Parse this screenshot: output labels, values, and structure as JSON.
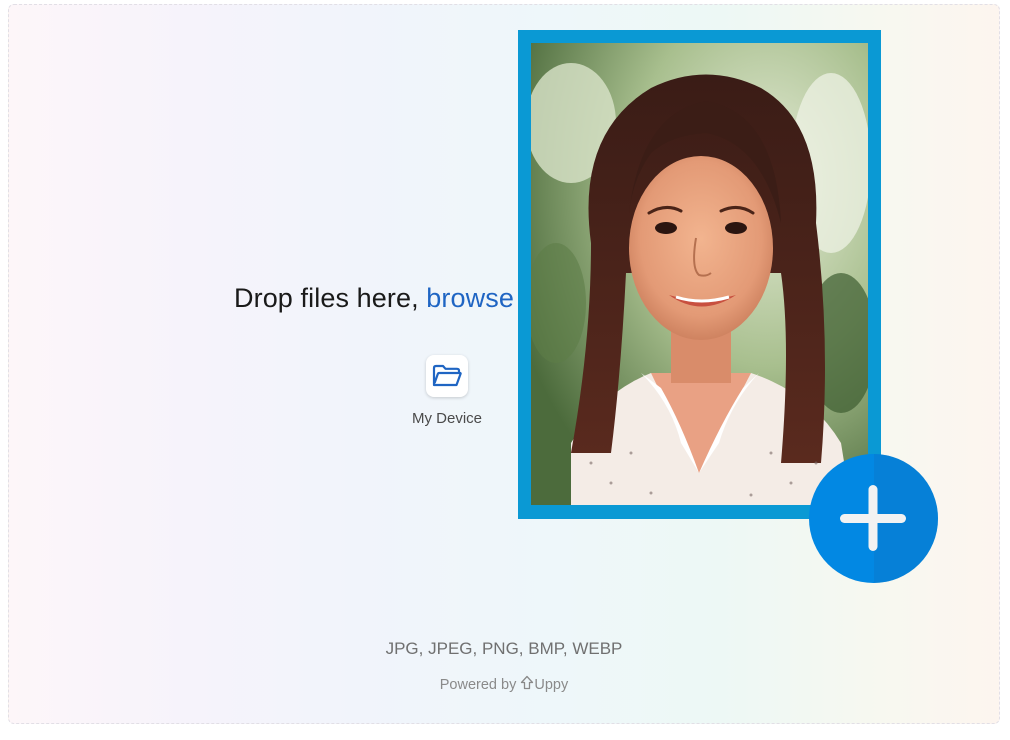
{
  "dropzone": {
    "title_prefix": "Drop files here, ",
    "browse_label": "browse"
  },
  "sources": [
    {
      "label": "My Device",
      "icon": "folder-icon"
    }
  ],
  "file_types": "JPG, JPEG, PNG, BMP, WEBP",
  "footer": {
    "powered_by": "Powered by",
    "brand": "Uppy",
    "brand_icon": "uppy-arrow-icon"
  },
  "preview": {
    "image_description": "Portrait photo of smiling woman",
    "frame_color": "#0a99d4"
  },
  "add_button": {
    "icon": "plus-icon",
    "color": "#0288e3"
  },
  "colors": {
    "link": "#1f65c3",
    "icon_blue": "#1f65c3"
  }
}
